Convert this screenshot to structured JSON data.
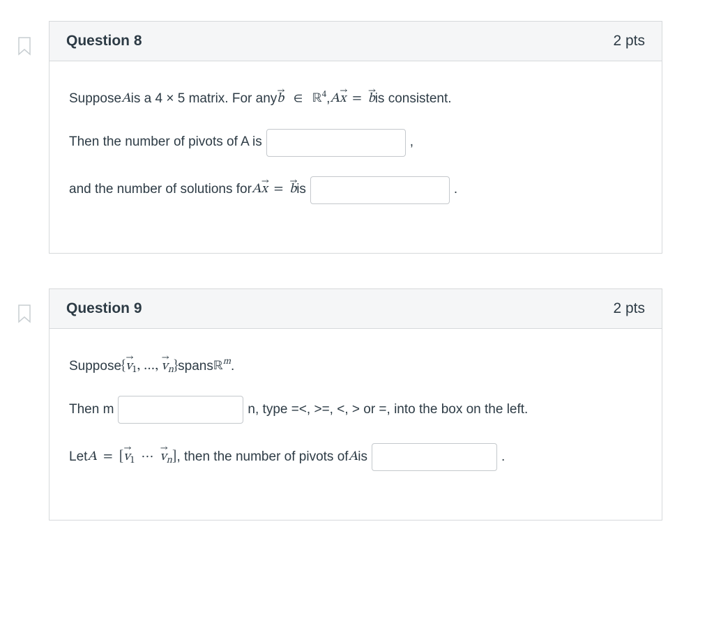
{
  "q8": {
    "title": "Question 8",
    "points": "2 pts",
    "line1_a": "Suppose ",
    "line1_b": " is a 4 × 5 matrix. For any ",
    "line1_c": ", ",
    "line1_d": " is consistent.",
    "line2_a": "Then the number of pivots of A is ",
    "line2_b": " ,",
    "line3_a": "and the number of solutions for ",
    "line3_b": " is ",
    "line3_c": " ."
  },
  "q9": {
    "title": "Question 9",
    "points": "2 pts",
    "line1_a": "Suppose ",
    "line1_b": " spans ",
    "line1_c": " .",
    "line2_a": "Then m ",
    "line2_b": " n, type =<, >=, <, > or =, into the box on the left.",
    "line3_a": "Let ",
    "line3_b": ", then the number of pivots of ",
    "line3_c": " is ",
    "line3_d": " ."
  },
  "math": {
    "A": "A",
    "b": "b",
    "x": "x",
    "v": "v",
    "R": "ℝ",
    "in": "∈",
    "eq": "=",
    "four": "4",
    "m": "m",
    "one": "1",
    "n": "n",
    "dots": "…",
    "cdots": "⋯",
    "lbrace": "{",
    "rbrace": "}",
    "lbrack": "[",
    "rbrack": "]",
    "comma": ", "
  }
}
